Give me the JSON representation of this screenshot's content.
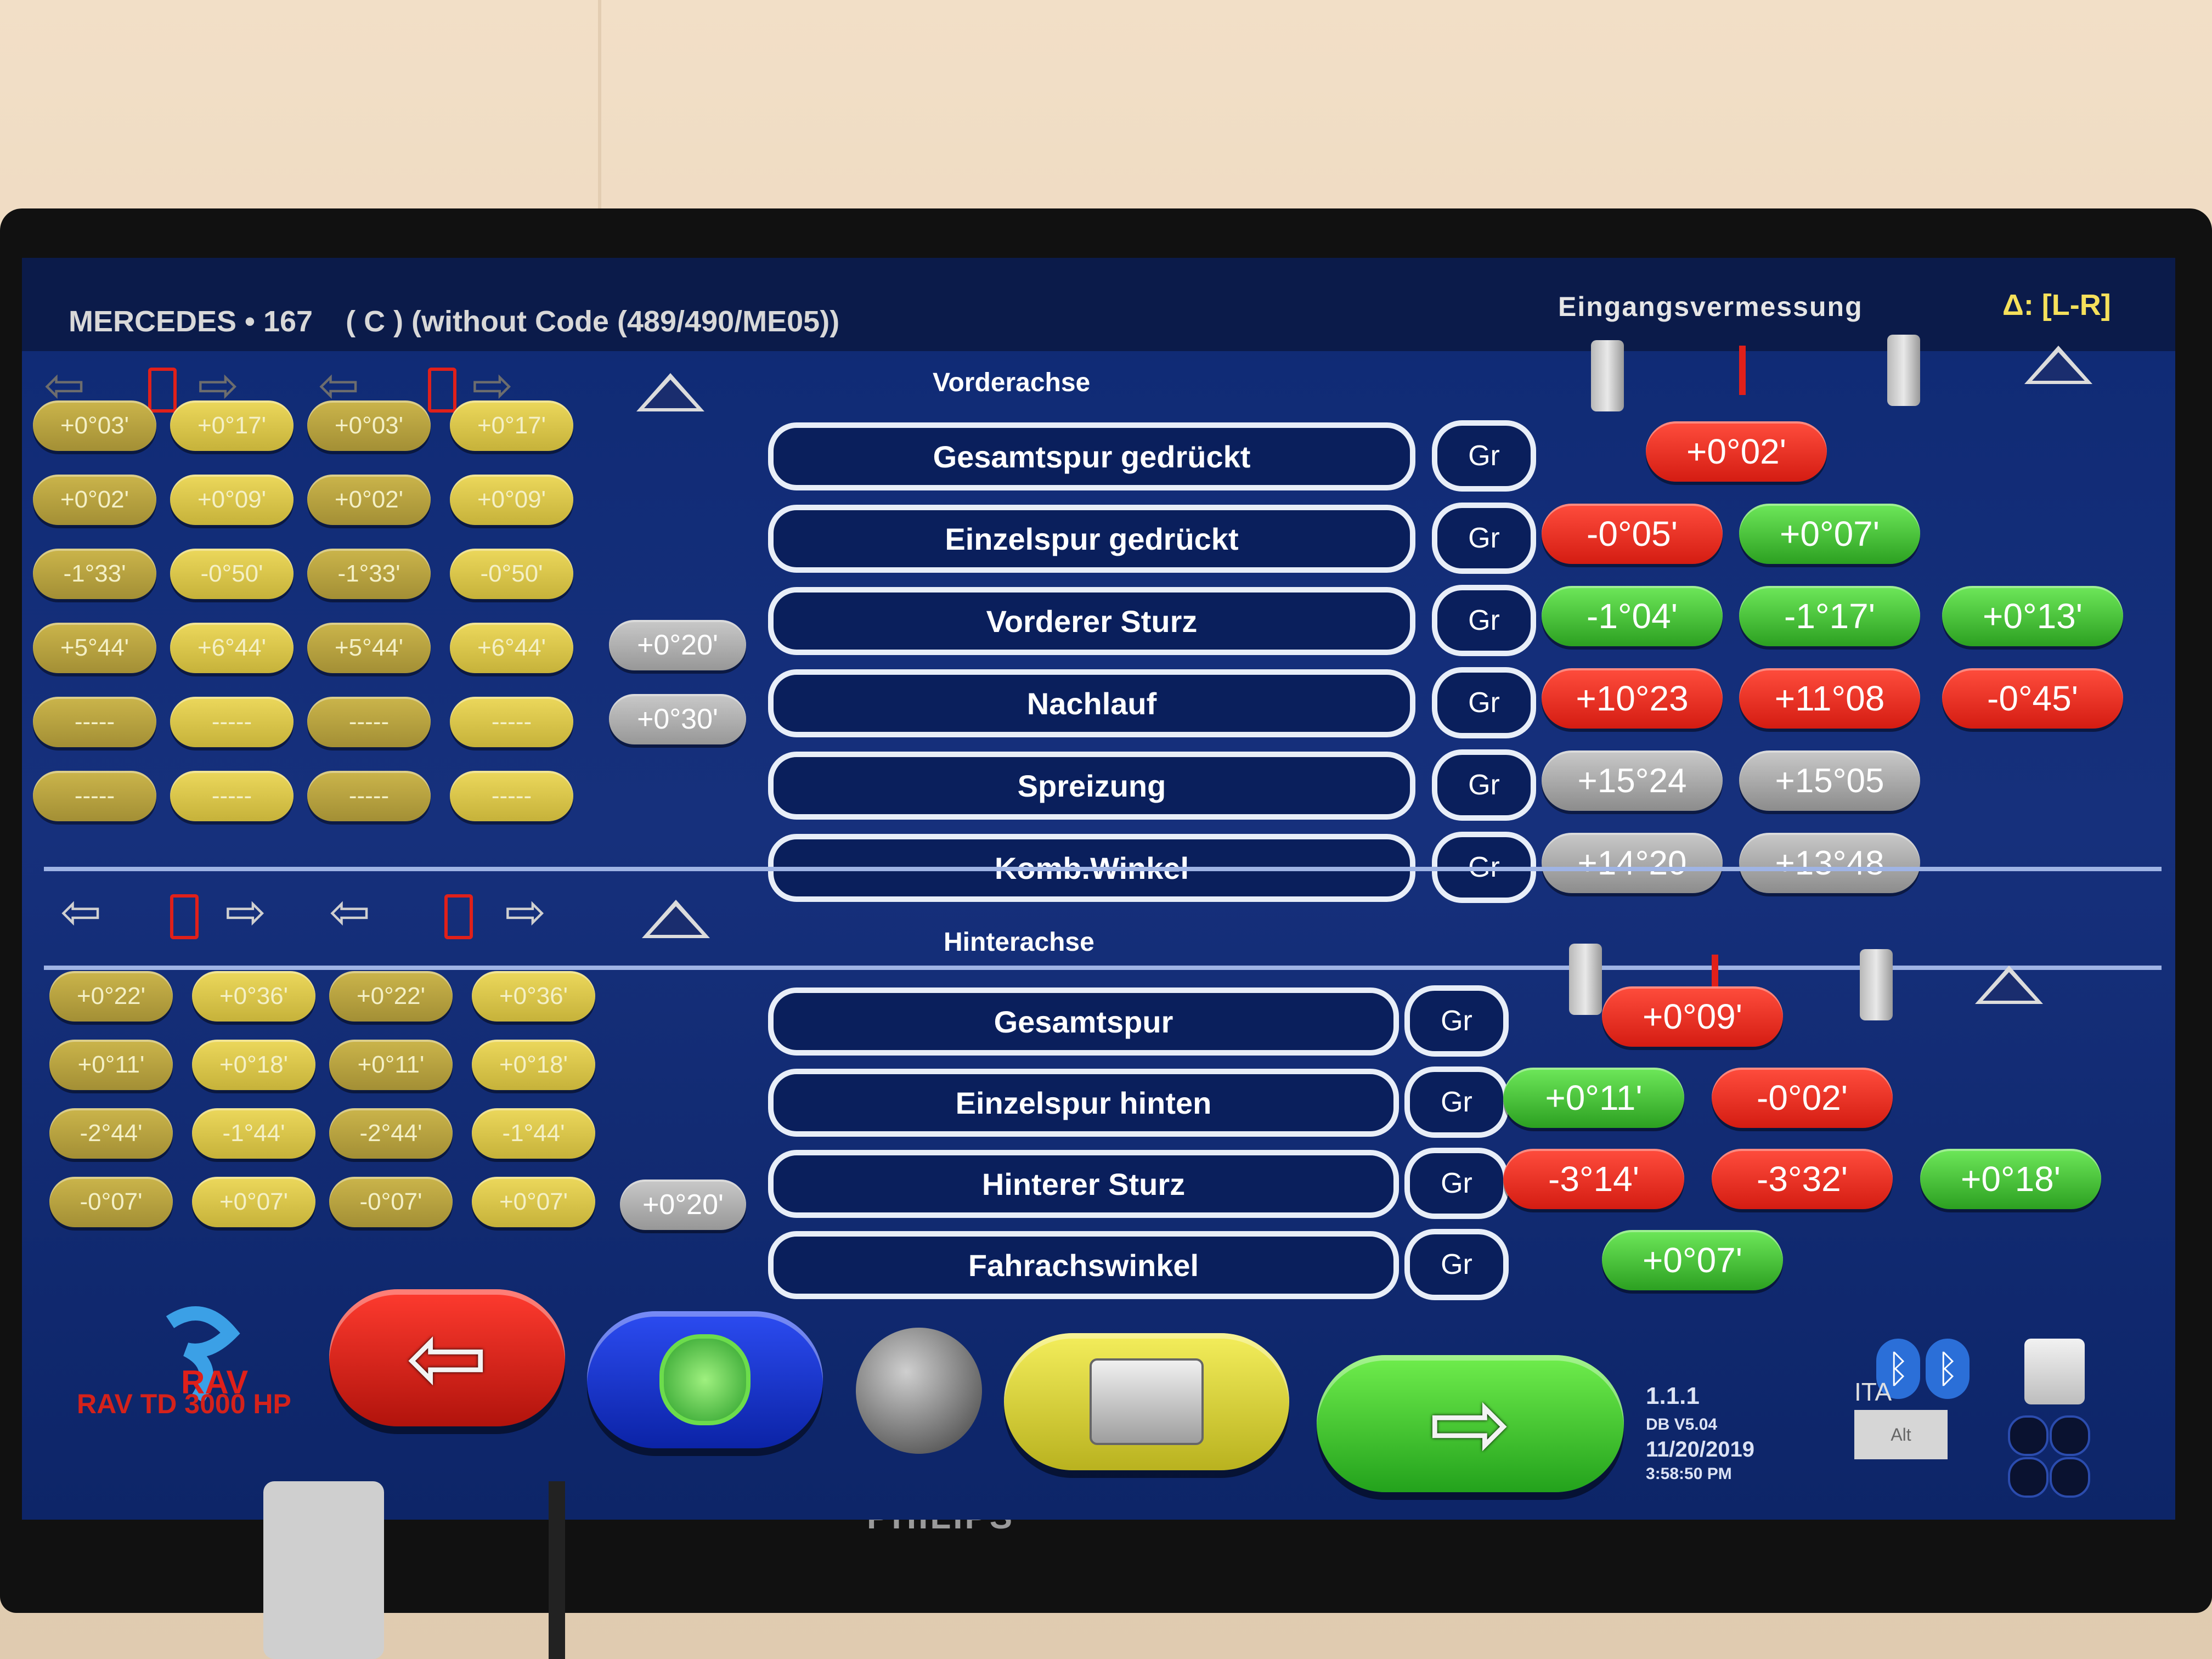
{
  "header": {
    "vehicle": "MERCEDES • 167",
    "variant": "( C ) (without Code (489/490/ME05))",
    "mode": "Eingangsvermessung",
    "delta": "Δ: [L-R]"
  },
  "front": {
    "section_label": "Vorderachse",
    "ref_rows": [
      [
        "+0°03'",
        "+0°17'",
        "+0°03'",
        "+0°17'"
      ],
      [
        "+0°02'",
        "+0°09'",
        "+0°02'",
        "+0°09'"
      ],
      [
        "-1°33'",
        "-0°50'",
        "-1°33'",
        "-0°50'"
      ],
      [
        "+5°44'",
        "+6°44'",
        "+5°44'",
        "+6°44'"
      ],
      [
        "-----",
        "-----",
        "-----",
        "-----"
      ],
      [
        "-----",
        "-----",
        "-----",
        "-----"
      ]
    ],
    "tolerances": [
      "+0°20'",
      "+0°30'"
    ],
    "measurements": [
      {
        "label": "Gesamtspur gedrückt",
        "gr": "Gr",
        "values": [
          {
            "v": "+0°02'",
            "c": "red"
          }
        ]
      },
      {
        "label": "Einzelspur gedrückt",
        "gr": "Gr",
        "values": [
          {
            "v": "-0°05'",
            "c": "red"
          },
          {
            "v": "+0°07'",
            "c": "grn"
          }
        ]
      },
      {
        "label": "Vorderer Sturz",
        "gr": "Gr",
        "values": [
          {
            "v": "-1°04'",
            "c": "grn"
          },
          {
            "v": "-1°17'",
            "c": "grn"
          },
          {
            "v": "+0°13'",
            "c": "grn"
          }
        ]
      },
      {
        "label": "Nachlauf",
        "gr": "Gr",
        "values": [
          {
            "v": "+10°23",
            "c": "red"
          },
          {
            "v": "+11°08",
            "c": "red"
          },
          {
            "v": "-0°45'",
            "c": "red"
          }
        ]
      },
      {
        "label": "Spreizung",
        "gr": "Gr",
        "values": [
          {
            "v": "+15°24",
            "c": "ref"
          },
          {
            "v": "+15°05",
            "c": "ref"
          }
        ]
      },
      {
        "label": "Komb.Winkel",
        "gr": "Gr",
        "values": [
          {
            "v": "+14°20",
            "c": "ref"
          },
          {
            "v": "+13°48",
            "c": "ref"
          }
        ]
      }
    ]
  },
  "rear": {
    "section_label": "Hinterachse",
    "ref_rows": [
      [
        "+0°22'",
        "+0°36'",
        "+0°22'",
        "+0°36'"
      ],
      [
        "+0°11'",
        "+0°18'",
        "+0°11'",
        "+0°18'"
      ],
      [
        "-2°44'",
        "-1°44'",
        "-2°44'",
        "-1°44'"
      ],
      [
        "-0°07'",
        "+0°07'",
        "-0°07'",
        "+0°07'"
      ]
    ],
    "tolerances": [
      "+0°20'"
    ],
    "measurements": [
      {
        "label": "Gesamtspur",
        "gr": "Gr",
        "values": [
          {
            "v": "+0°09'",
            "c": "red"
          }
        ]
      },
      {
        "label": "Einzelspur hinten",
        "gr": "Gr",
        "values": [
          {
            "v": "+0°11'",
            "c": "grn"
          },
          {
            "v": "-0°02'",
            "c": "red"
          }
        ]
      },
      {
        "label": "Hinterer Sturz",
        "gr": "Gr",
        "values": [
          {
            "v": "-3°14'",
            "c": "red"
          },
          {
            "v": "-3°32'",
            "c": "red"
          },
          {
            "v": "+0°18'",
            "c": "grn"
          }
        ]
      },
      {
        "label": "Fahrachswinkel",
        "gr": "Gr",
        "values": [
          {
            "v": "+0°07'",
            "c": "grn"
          }
        ]
      }
    ]
  },
  "footer": {
    "logo_text": "RAV TD 3000 HP",
    "version": "1.1.1",
    "db": "DB V5.04",
    "date": "11/20/2019",
    "time": "3:58:50 PM",
    "lang": "ITA",
    "alt": "Alt"
  },
  "monitor": {
    "brand": "PHILIPS"
  },
  "icons": {
    "back": "arrow-left-icon",
    "refresh": "refresh-icon",
    "print": "printer-icon",
    "next": "arrow-right-icon",
    "bluetooth": "bluetooth-icon"
  }
}
